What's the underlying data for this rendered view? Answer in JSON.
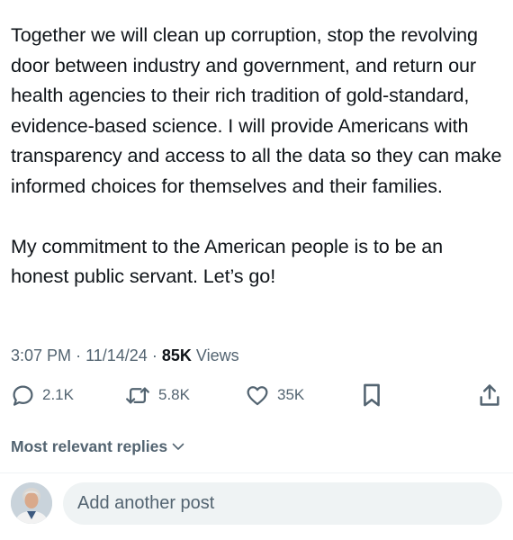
{
  "tweet": {
    "paragraphs": [
      "Together we will clean up corruption, stop the revolving door between industry and government, and return our health agencies to their rich tradition of gold-standard, evidence-based science. I will provide Americans with transparency and access to all the data so they can make informed choices for themselves and their families.",
      "My commitment to the American people is to be an honest public servant. Let’s go!"
    ],
    "time": "3:07 PM",
    "date": "11/14/24",
    "views_count": "85K",
    "views_label": "Views",
    "separator": "·"
  },
  "actions": {
    "reply": {
      "icon": "reply-icon",
      "count": "2.1K"
    },
    "repost": {
      "icon": "repost-icon",
      "count": "5.8K"
    },
    "like": {
      "icon": "heart-icon",
      "count": "35K"
    },
    "bookmark": {
      "icon": "bookmark-icon"
    },
    "share": {
      "icon": "share-icon"
    }
  },
  "replies": {
    "sort_label": "Most relevant replies",
    "icon": "chevron-down-icon"
  },
  "composer": {
    "placeholder": "Add another post",
    "avatar_icon": "avatar"
  },
  "colors": {
    "text_primary": "#0f1419",
    "text_secondary": "#536471",
    "input_bg": "#eff3f4",
    "divider": "#eff3f4"
  }
}
